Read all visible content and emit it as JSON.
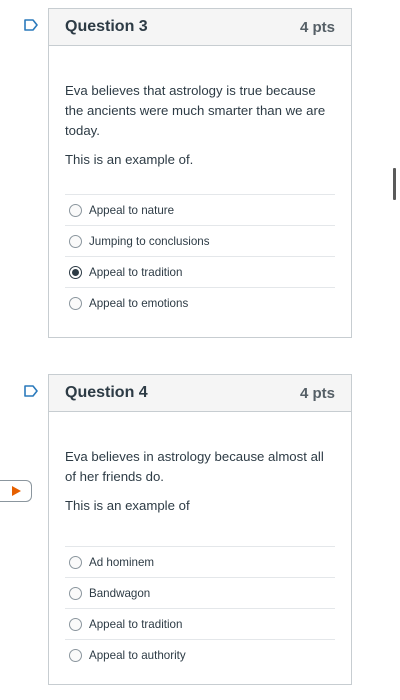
{
  "questions": [
    {
      "title": "Question 3",
      "points": "4 pts",
      "text": "Eva believes that astrology is true because the ancients were much smarter than we are today.",
      "prompt": "This is an example of.",
      "answers": [
        {
          "label": "Appeal to nature",
          "selected": false
        },
        {
          "label": "Jumping to conclusions",
          "selected": false
        },
        {
          "label": "Appeal to tradition",
          "selected": true
        },
        {
          "label": "Appeal to emotions",
          "selected": false
        }
      ]
    },
    {
      "title": "Question 4",
      "points": "4 pts",
      "text": "Eva believes in astrology because almost all of her friends do.",
      "prompt": "This is an example of",
      "answers": [
        {
          "label": "Ad hominem",
          "selected": false
        },
        {
          "label": "Bandwagon",
          "selected": false
        },
        {
          "label": "Appeal to tradition",
          "selected": false
        },
        {
          "label": "Appeal to authority",
          "selected": false
        }
      ]
    }
  ],
  "icons": {
    "flag": "flag-outline-icon",
    "side_tab": "play-arrow-icon"
  },
  "colors": {
    "flag": "#2b7abc",
    "play_arrow": "#e66000",
    "header_bg": "#f5f5f5",
    "border": "#c7cdd1"
  }
}
